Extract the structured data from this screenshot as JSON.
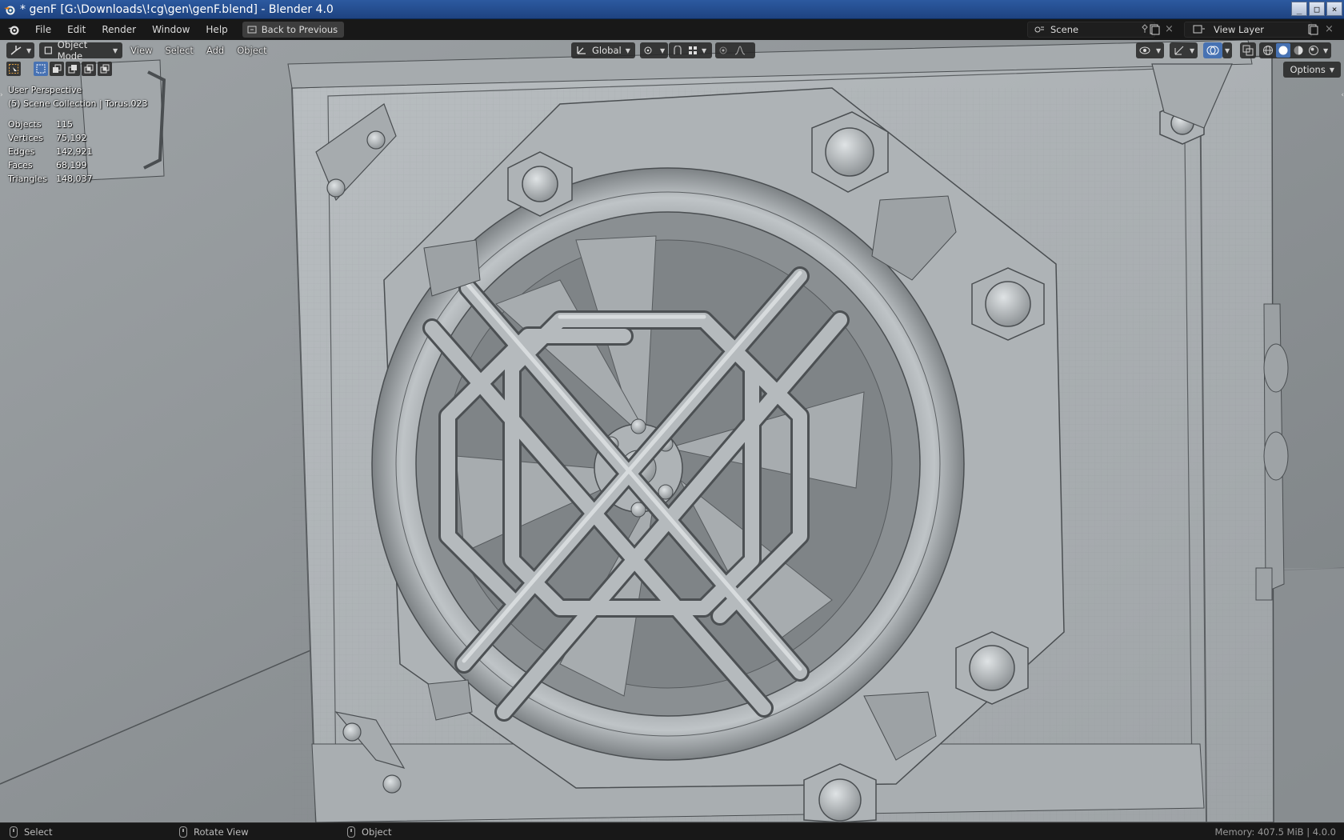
{
  "window": {
    "title": "* genF [G:\\Downloads\\!cg\\gen\\genF.blend] - Blender 4.0",
    "minimize": "_",
    "maximize": "□",
    "close": "×"
  },
  "menubar": {
    "items": [
      "File",
      "Edit",
      "Render",
      "Window",
      "Help"
    ],
    "back_button": "Back to Previous",
    "scene_label": "Scene",
    "view_layer_label": "View Layer"
  },
  "viewport_header": {
    "mode": "Object Mode",
    "menus": [
      "View",
      "Select",
      "Add",
      "Object"
    ],
    "transform_orientation": "Global",
    "options": "Options"
  },
  "overlay": {
    "perspective": "User Perspective",
    "collection": "(5) Scene Collection | Torus.023",
    "stats": [
      {
        "label": "Objects",
        "value": "115"
      },
      {
        "label": "Vertices",
        "value": "75,192"
      },
      {
        "label": "Edges",
        "value": "142,921"
      },
      {
        "label": "Faces",
        "value": "68,199"
      },
      {
        "label": "Triangles",
        "value": "148,037"
      }
    ]
  },
  "statusbar": {
    "select": "Select",
    "rotate": "Rotate View",
    "object": "Object",
    "memory": "Memory: 407.5 MiB | 4.0.0"
  },
  "colors": {
    "accent": "#4772b3",
    "title_bar": "#2c5aa0",
    "viewport_bg": "#8c9194",
    "header_bg": "#181818"
  },
  "icons": [
    "blender-logo-icon",
    "editor-type-icon",
    "object-mode-icon",
    "transform-icon",
    "pivot-icon",
    "snap-icon",
    "proportional-icon",
    "visibility-icon",
    "gizmo-icon",
    "overlay-icon",
    "xray-icon",
    "wireframe-shading-icon",
    "solid-shading-icon",
    "material-shading-icon",
    "rendered-shading-icon",
    "new-scene-icon",
    "pin-icon",
    "mouse-left-icon",
    "mouse-middle-icon",
    "mouse-right-icon"
  ]
}
